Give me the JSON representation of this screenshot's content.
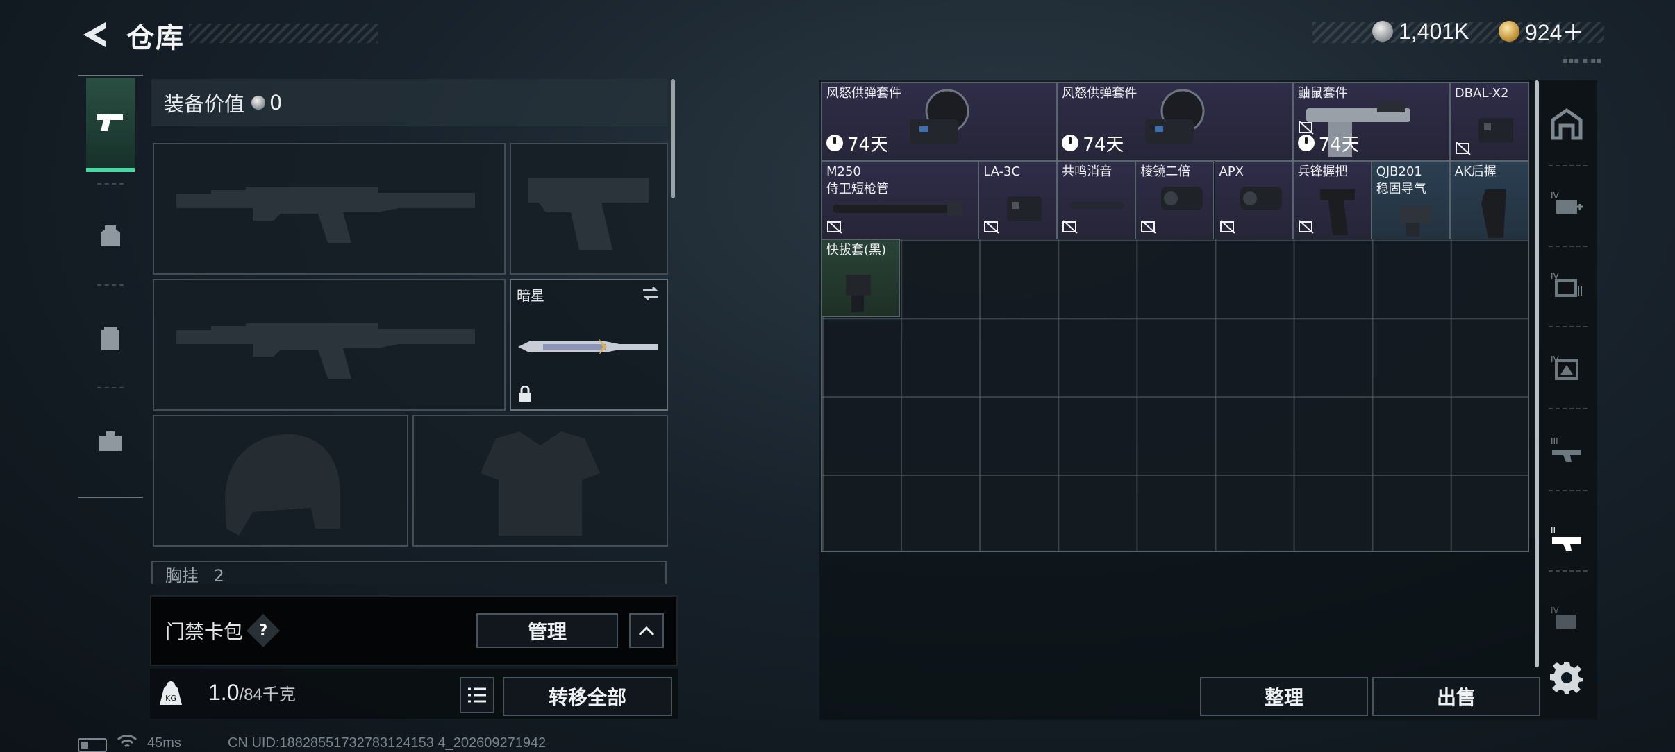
{
  "header": {
    "title": "仓库",
    "currency_silver": "1,401K",
    "currency_gold": "924＋"
  },
  "loadout": {
    "value_label": "装备价值",
    "value": "0",
    "melee_name": "暗星",
    "chest_label": "胸挂",
    "chest_count": "2"
  },
  "keycard": {
    "label": "门禁卡包",
    "help": "?",
    "manage_button": "管理"
  },
  "weight": {
    "current": "1.0",
    "capacity": "/84千克",
    "transfer_all_button": "转移全部"
  },
  "storage": {
    "items": [
      {
        "name": "风怒供弹套件",
        "sub": "",
        "timer": "74天",
        "rarity": "purple",
        "icon": "drum-magazine-kit"
      },
      {
        "name": "风怒供弹套件",
        "sub": "",
        "timer": "74天",
        "rarity": "purple",
        "icon": "drum-magazine-kit"
      },
      {
        "name": "鼬鼠套件",
        "sub": "",
        "timer": "74天",
        "rarity": "purple",
        "icon": "weasel-kit"
      },
      {
        "name": "DBAL-X2",
        "sub": "",
        "timer": "",
        "rarity": "purple",
        "icon": "laser-module"
      },
      {
        "name": "M250",
        "sub": "侍卫短枪管",
        "timer": "",
        "rarity": "purple",
        "icon": "barrel"
      },
      {
        "name": "LA-3C",
        "sub": "",
        "timer": "",
        "rarity": "purple",
        "icon": "laser-module"
      },
      {
        "name": "共鸣消音",
        "sub": "",
        "timer": "",
        "rarity": "purple",
        "icon": "suppressor"
      },
      {
        "name": "棱镜二倍",
        "sub": "",
        "timer": "",
        "rarity": "purple",
        "icon": "scope"
      },
      {
        "name": "APX",
        "sub": "",
        "timer": "",
        "rarity": "purple",
        "icon": "scope"
      },
      {
        "name": "兵锋握把",
        "sub": "",
        "timer": "",
        "rarity": "purple",
        "icon": "grip"
      },
      {
        "name": "QJB201",
        "sub": "稳固导气",
        "timer": "",
        "rarity": "blue",
        "icon": "gas-block"
      },
      {
        "name": "AK后握",
        "sub": "",
        "timer": "",
        "rarity": "blue",
        "icon": "pistol-grip"
      },
      {
        "name": "快拔套(黑)",
        "sub": "",
        "timer": "",
        "rarity": "green",
        "icon": "holster"
      }
    ],
    "sort_button": "整理",
    "sell_button": "出售"
  },
  "footer": {
    "latency": "45ms",
    "uid": "CN UID:18828551732783124153 4_202609271942"
  },
  "colors": {
    "accent_green": "#44d9a0",
    "rarity_purple": "#2f2d48",
    "rarity_blue": "#2b3f52",
    "rarity_green": "#294236"
  }
}
